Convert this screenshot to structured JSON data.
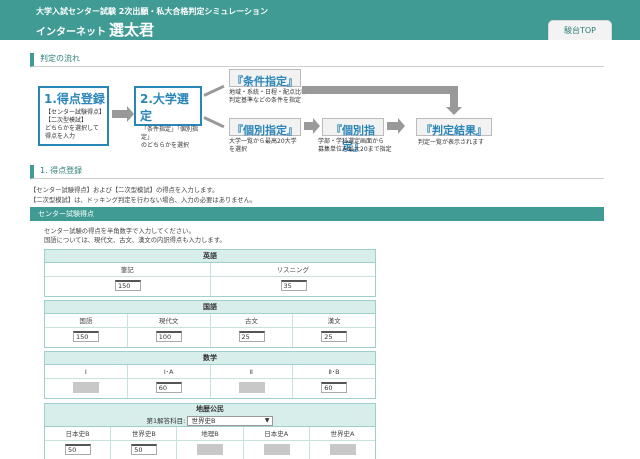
{
  "header": {
    "subtitle": "大学入試センター試験 2次出願・私大合格判定シミュレーション",
    "title_prefix": "インターネット",
    "title_main": "選太君",
    "top_link": "駿台TOP"
  },
  "flow": {
    "heading": "判定の流れ",
    "step1": {
      "title": "1.得点登録",
      "text": [
        "【センター試験得点】",
        "【二次型模試】",
        "どちらかを選択して",
        "得点を入力"
      ]
    },
    "step2": {
      "title": "2.大学選定",
      "text": [
        "「条件指定」「個別指定」",
        "のどちらかを選択"
      ]
    },
    "joken": {
      "title": "『条件指定』",
      "text": [
        "地域・系統・日程・配点比率・",
        "判定基準などの条件を指定"
      ]
    },
    "kobetsu": {
      "title": "『個別指定』",
      "text": [
        "大学一覧から最高20大学",
        "を選択"
      ]
    },
    "kobetsu2": {
      "title": "『個別指定』",
      "text": [
        "学部・学科選定画面から",
        "募集単位を最大20まで指定"
      ]
    },
    "result": {
      "title": "『判定結果』",
      "text": [
        "判定一覧が表示されます"
      ]
    }
  },
  "section1": {
    "heading": "1. 得点登録",
    "notes": [
      "【センター試験得点】および【二次型模試】の得点を入力します。",
      "【二次型模試】は、ドッキング判定を行わない場合、入力の必要はありません。"
    ],
    "band": "センター試験得点",
    "instructions": [
      "センター試験の得点を半角数字で入力してください。",
      "国語については、現代文、古文、漢文の内訳得点も入力します。"
    ]
  },
  "tables": {
    "english": {
      "caption": "英語",
      "cols": [
        "筆記",
        "リスニング"
      ],
      "values": [
        "150",
        "35"
      ]
    },
    "japanese": {
      "caption": "国語",
      "cols": [
        "国語",
        "現代文",
        "古文",
        "漢文"
      ],
      "values": [
        "150",
        "100",
        "25",
        "25"
      ]
    },
    "math": {
      "caption": "数学",
      "cols": [
        "Ⅰ",
        "Ⅰ･A",
        "Ⅱ",
        "Ⅱ･B"
      ],
      "values": [
        "",
        "60",
        "",
        "60"
      ],
      "disabled": [
        true,
        false,
        true,
        false
      ]
    },
    "social": {
      "caption": "地歴公民",
      "select_label": "第1解答科目:",
      "select_value": "世界史B",
      "cols": [
        "日本史B",
        "世界史B",
        "地理B",
        "日本史A",
        "世界史A"
      ],
      "values": [
        "50",
        "50",
        "",
        "",
        ""
      ],
      "disabled": [
        false,
        false,
        true,
        true,
        true
      ]
    }
  },
  "colors": {
    "accent": "#3f9b94",
    "step_blue": "#2a86b8"
  }
}
